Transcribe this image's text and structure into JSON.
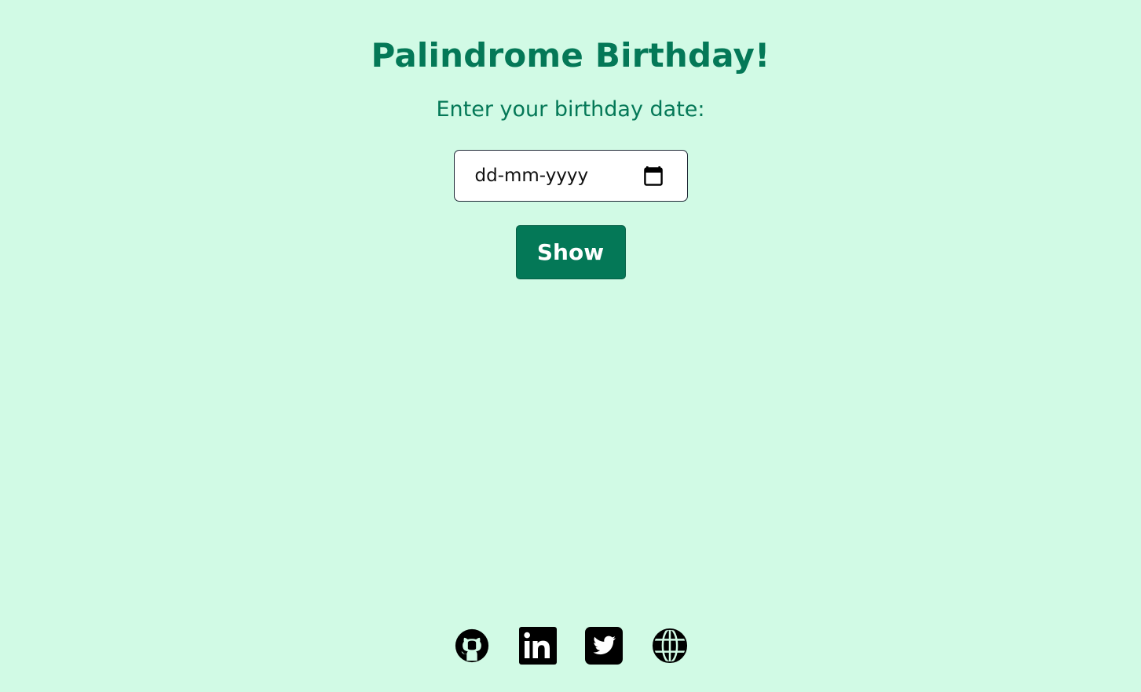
{
  "header": {
    "title": "Palindrome Birthday!"
  },
  "form": {
    "prompt": "Enter your birthday date:",
    "date_placeholder": "dd-mm-yyyy",
    "show_label": "Show"
  },
  "footer": {
    "links": [
      {
        "icon": "github-icon"
      },
      {
        "icon": "linkedin-icon"
      },
      {
        "icon": "twitter-icon"
      },
      {
        "icon": "globe-icon"
      }
    ]
  },
  "colors": {
    "background": "#d1fae5",
    "accent": "#047857",
    "icon": "#000000"
  }
}
